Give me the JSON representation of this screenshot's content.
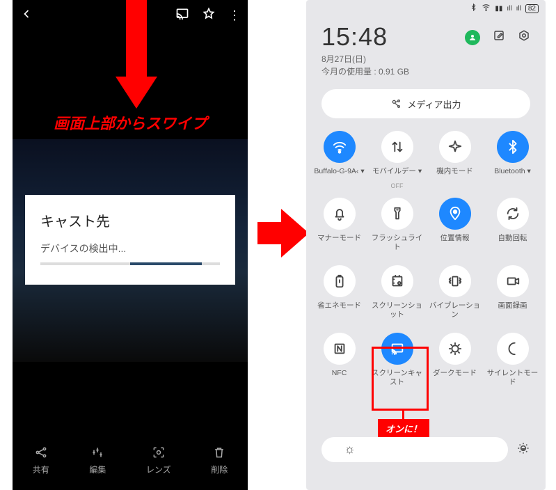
{
  "left": {
    "annotation": "画面上部からスワイプ",
    "cast_title": "キャスト先",
    "cast_searching": "デバイスの検出中...",
    "actions": {
      "share": "共有",
      "edit": "編集",
      "lens": "レンズ",
      "delete": "削除"
    }
  },
  "right": {
    "status": {
      "battery": "82"
    },
    "time": "15:48",
    "date": "8月27日(日)",
    "usage": "今月の使用量 : 0.91 GB",
    "media_output": "メディア出力",
    "tiles": [
      {
        "label": "Buffalo-G-9A‹",
        "sub": "",
        "on": true,
        "icon": "wifi",
        "dd": true
      },
      {
        "label": "モバイルデー",
        "sub": "OFF",
        "on": false,
        "icon": "data",
        "dd": true
      },
      {
        "label": "機内モード",
        "sub": "",
        "on": false,
        "icon": "airplane"
      },
      {
        "label": "Bluetooth",
        "sub": "",
        "on": true,
        "icon": "bluetooth",
        "dd": true
      },
      {
        "label": "マナーモード",
        "sub": "",
        "on": false,
        "icon": "bell"
      },
      {
        "label": "フラッシュライト",
        "sub": "",
        "on": false,
        "icon": "flashlight"
      },
      {
        "label": "位置情報",
        "sub": "",
        "on": true,
        "icon": "location"
      },
      {
        "label": "自動回転",
        "sub": "",
        "on": false,
        "icon": "rotate"
      },
      {
        "label": "省エネモード",
        "sub": "",
        "on": false,
        "icon": "battery"
      },
      {
        "label": "スクリーンショット",
        "sub": "",
        "on": false,
        "icon": "screenshot"
      },
      {
        "label": "バイブレーション",
        "sub": "",
        "on": false,
        "icon": "vibrate"
      },
      {
        "label": "画面録画",
        "sub": "",
        "on": false,
        "icon": "record"
      },
      {
        "label": "NFC",
        "sub": "",
        "on": false,
        "icon": "nfc"
      },
      {
        "label": "スクリーンキャスト",
        "sub": "",
        "on": true,
        "icon": "cast"
      },
      {
        "label": "ダークモード",
        "sub": "",
        "on": false,
        "icon": "dark"
      },
      {
        "label": "サイレントモード",
        "sub": "",
        "on": false,
        "icon": "silent"
      }
    ],
    "on_annotation": "オンに！"
  }
}
